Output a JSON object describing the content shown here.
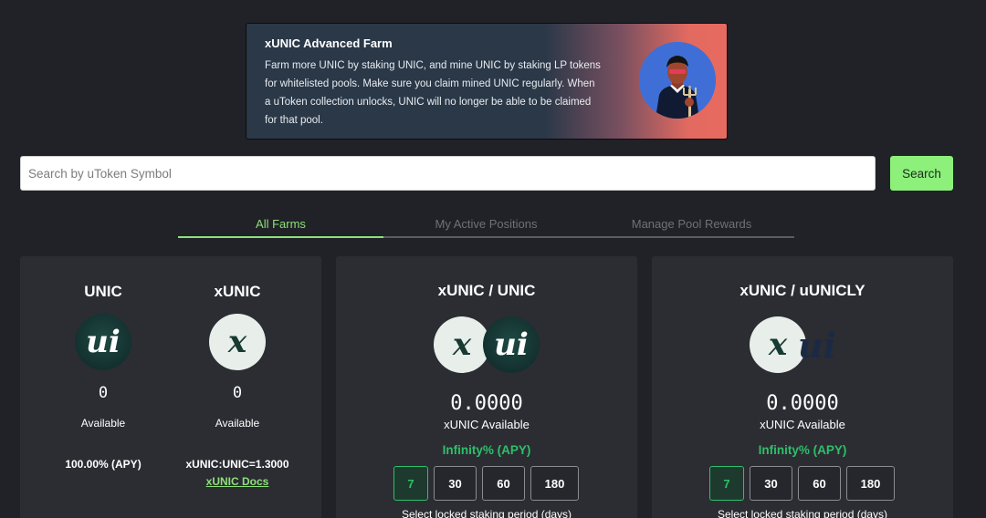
{
  "banner": {
    "title": "xUNIC Advanced Farm",
    "text": "Farm more UNIC by staking UNIC, and mine UNIC by staking LP tokens for whitelisted pools. Make sure you claim mined UNIC regularly. When a uToken collection unlocks, UNIC will no longer be able to be claimed for that pool."
  },
  "search": {
    "placeholder": "Search by uToken Symbol",
    "value": "",
    "button_label": "Search"
  },
  "tabs": [
    {
      "label": "All Farms",
      "active": true
    },
    {
      "label": "My Active Positions",
      "active": false
    },
    {
      "label": "Manage Pool Rewards",
      "active": false
    }
  ],
  "card1": {
    "left": {
      "title": "UNIC",
      "icon": "ui",
      "value": "0",
      "label": "Available",
      "stat": "100.00% (APY)"
    },
    "right": {
      "title": "xUNIC",
      "icon": "x",
      "value": "0",
      "label": "Available",
      "stat": "xUNIC:UNIC=1.3000",
      "link": "xUNIC Docs"
    }
  },
  "card2": {
    "title": "xUNIC / UNIC",
    "icons": [
      "x",
      "ui"
    ],
    "value": "0.0000",
    "available_label": "xUNIC Available",
    "apy": "Infinity% (APY)",
    "periods": [
      "7",
      "30",
      "60",
      "180"
    ],
    "selected_period": "7",
    "caption": "Select locked staking period (days)"
  },
  "card3": {
    "title": "xUNIC / uUNICLY",
    "icons": [
      "x",
      "ui"
    ],
    "value": "0.0000",
    "available_label": "xUNIC Available",
    "apy": "Infinity% (APY)",
    "periods": [
      "7",
      "30",
      "60",
      "180"
    ],
    "selected_period": "7",
    "caption": "Select locked staking period (days)"
  },
  "colors": {
    "accent_green": "#8ee07a",
    "apy_green": "#2fbf6a",
    "background": "#202227",
    "card": "#2b2d33"
  }
}
